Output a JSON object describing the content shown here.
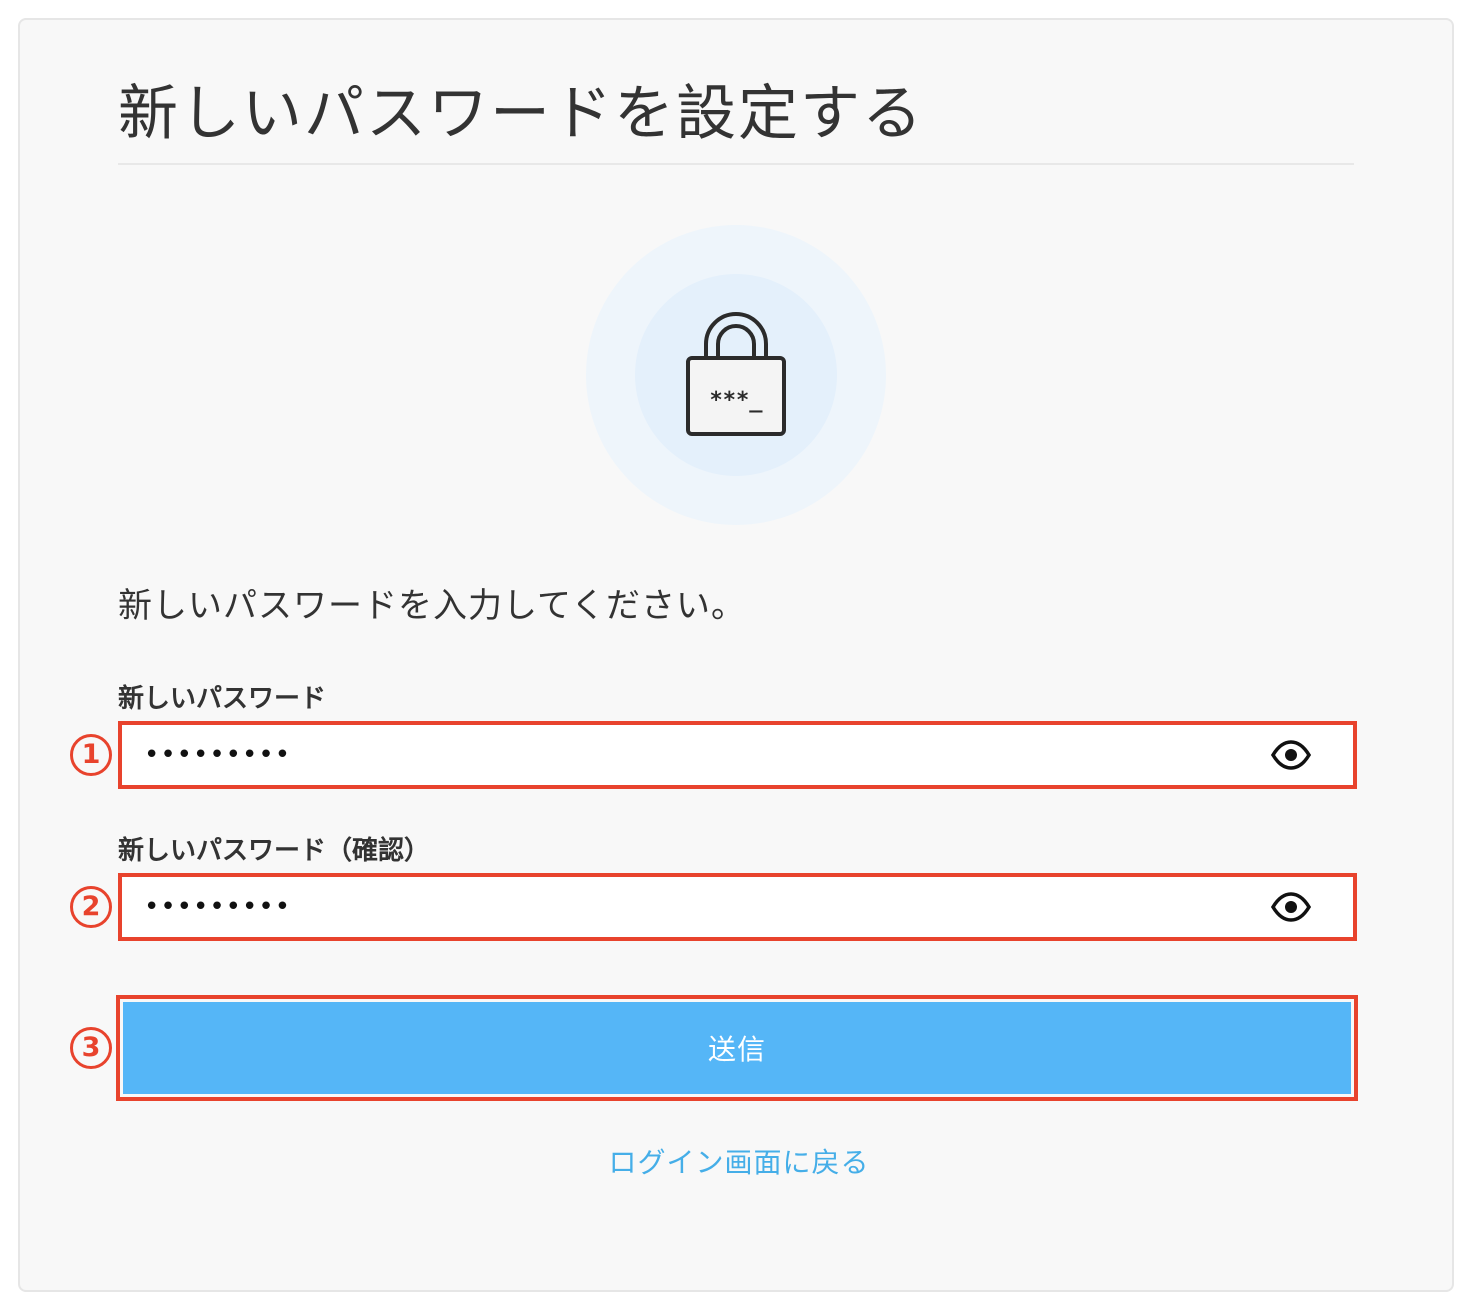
{
  "page": {
    "title": "新しいパスワードを設定する",
    "instruction": "新しいパスワードを入力してください。"
  },
  "lock_icon": {
    "name": "password-lock-icon",
    "text": "***_"
  },
  "fields": [
    {
      "marker": "1",
      "label": "新しいパスワード",
      "masked_value": "•••••••••",
      "toggle_icon": "eye-icon"
    },
    {
      "marker": "2",
      "label": "新しいパスワード（確認）",
      "masked_value": "•••••••••",
      "toggle_icon": "eye-icon"
    }
  ],
  "submit": {
    "marker": "3",
    "label": "送信"
  },
  "back_link": {
    "label": "ログイン画面に戻る"
  },
  "colors": {
    "highlight_border": "#e8432d",
    "button_bg": "#55b6f7",
    "link": "#45aee8",
    "card_bg": "#f8f8f8"
  }
}
